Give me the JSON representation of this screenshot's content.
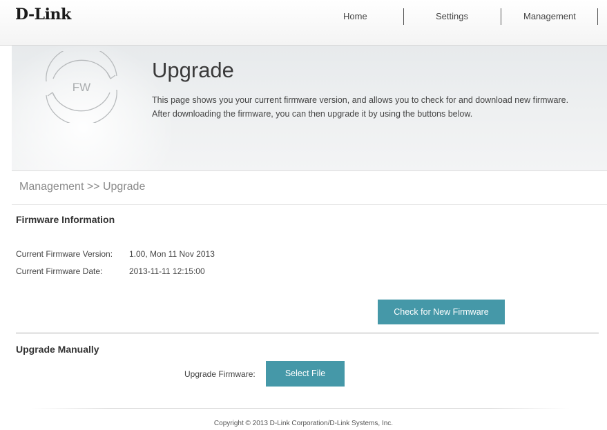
{
  "header": {
    "logo": "D-Link",
    "nav": [
      {
        "label": "Home"
      },
      {
        "label": "Settings"
      },
      {
        "label": "Management"
      }
    ]
  },
  "banner": {
    "icon_text": "FW",
    "icon": "firmware-refresh-icon",
    "title": "Upgrade",
    "description": "This page shows you your current firmware version, and allows you to check for and download new firmware. After downloading the firmware, you can then upgrade it by using the buttons below."
  },
  "breadcrumb": "Management >> Upgrade",
  "firmware_info": {
    "title": "Firmware Information",
    "version_label": "Current Firmware Version:",
    "version_value": "1.00, Mon 11 Nov 2013",
    "date_label": "Current Firmware Date:",
    "date_value": "2013-11-11 12:15:00",
    "check_button": "Check for New Firmware"
  },
  "upgrade_manual": {
    "title": "Upgrade Manually",
    "label": "Upgrade Firmware:",
    "select_button": "Select File"
  },
  "footer": {
    "copyright": "Copyright © 2013 D-Link Corporation/D-Link Systems, Inc."
  },
  "colors": {
    "button": "#4598a8",
    "banner_bg": "#eceeef",
    "text": "#333333"
  }
}
